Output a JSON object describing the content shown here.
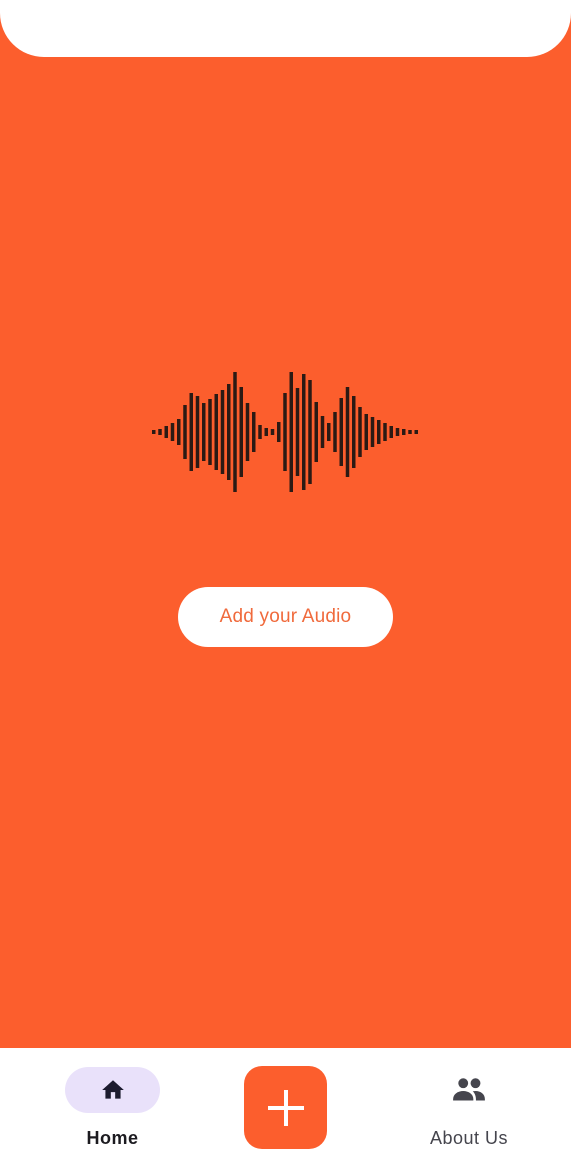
{
  "main": {
    "add_audio_label": "Add your Audio",
    "background_color": "#FC5E2D",
    "waveform_icon": "audio-waveform-icon"
  },
  "bottom_nav": {
    "items": [
      {
        "label": "Home",
        "icon": "home-icon",
        "selected": true
      },
      {
        "label": "add",
        "icon": "plus-icon",
        "selected": false
      },
      {
        "label": "About Us",
        "icon": "group-icon",
        "selected": false
      }
    ],
    "active_pill_color": "#E9E1FA",
    "fab_color": "#FC5E2D"
  }
}
